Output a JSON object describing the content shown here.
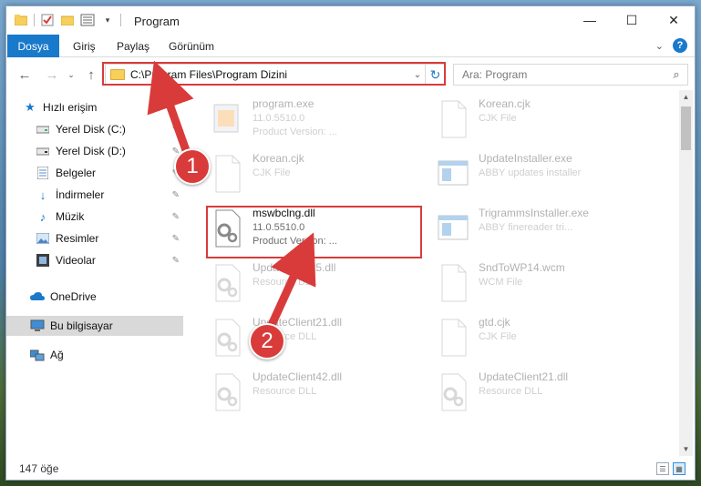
{
  "window": {
    "title": "Program",
    "controls": {
      "minimize": "—",
      "maximize": "☐",
      "close": "✕"
    }
  },
  "ribbon": {
    "tabs": [
      "Dosya",
      "Giriş",
      "Paylaş",
      "Görünüm"
    ],
    "help": "?"
  },
  "navigation": {
    "address": "C:\\Program Files\\Program Dizini",
    "search_placeholder": "Ara: Program"
  },
  "sidebar": {
    "items": [
      {
        "label": "Hızlı erişim",
        "icon": "star-icon",
        "pinned": false
      },
      {
        "label": "Yerel Disk (C:)",
        "icon": "drive-icon",
        "pinned": true
      },
      {
        "label": "Yerel Disk (D:)",
        "icon": "drive-icon",
        "pinned": true
      },
      {
        "label": "Belgeler",
        "icon": "documents-icon",
        "pinned": true
      },
      {
        "label": "İndirmeler",
        "icon": "download-icon",
        "pinned": true
      },
      {
        "label": "Müzik",
        "icon": "music-icon",
        "pinned": true
      },
      {
        "label": "Resimler",
        "icon": "pictures-icon",
        "pinned": true
      },
      {
        "label": "Videolar",
        "icon": "videos-icon",
        "pinned": true
      },
      {
        "label": "OneDrive",
        "icon": "cloud-icon",
        "pinned": false
      },
      {
        "label": "Bu bilgisayar",
        "icon": "computer-icon",
        "pinned": false,
        "selected": true
      },
      {
        "label": "Ağ",
        "icon": "network-icon",
        "pinned": false
      }
    ],
    "pin_glyph": "✎"
  },
  "files": [
    {
      "name": "program.exe",
      "line1": "11.0.5510.0",
      "line2": "Product Version:   ...",
      "icon": "exe-icon"
    },
    {
      "name": "Korean.cjk",
      "line1": "CJK File",
      "line2": "",
      "icon": "generic-file-icon"
    },
    {
      "name": "Korean.cjk",
      "line1": "CJK File",
      "line2": "",
      "icon": "generic-file-icon"
    },
    {
      "name": "UpdateInstaller.exe",
      "line1": "ABBY updates installer",
      "line2": "",
      "icon": "installer-icon"
    },
    {
      "name": "mswbclng.dll",
      "line1": "11.0.5510.0",
      "line2": "Product Version:   ...",
      "icon": "dll-gear-icon"
    },
    {
      "name": "TrigrammsInstaller.exe",
      "line1": "ABBY finereader tri...",
      "line2": "",
      "icon": "installer-icon"
    },
    {
      "name": "UpdateClient5.dll",
      "line1": "Resource DLL",
      "line2": "",
      "icon": "dll-gear-icon"
    },
    {
      "name": "SndToWP14.wcm",
      "line1": "WCM File",
      "line2": "",
      "icon": "generic-file-icon"
    },
    {
      "name": "UpdateClient21.dll",
      "line1": "Resource DLL",
      "line2": "",
      "icon": "dll-gear-icon"
    },
    {
      "name": "gtd.cjk",
      "line1": "CJK File",
      "line2": "",
      "icon": "generic-file-icon"
    },
    {
      "name": "UpdateClient42.dll",
      "line1": "Resource DLL",
      "line2": "",
      "icon": "dll-gear-icon"
    },
    {
      "name": "UpdateClient21.dll",
      "line1": "Resource DLL",
      "line2": "",
      "icon": "dll-gear-icon"
    }
  ],
  "status": {
    "count": "147 öğe"
  },
  "annotations": {
    "step1": "1",
    "step2": "2",
    "color": "#d93b3b"
  }
}
